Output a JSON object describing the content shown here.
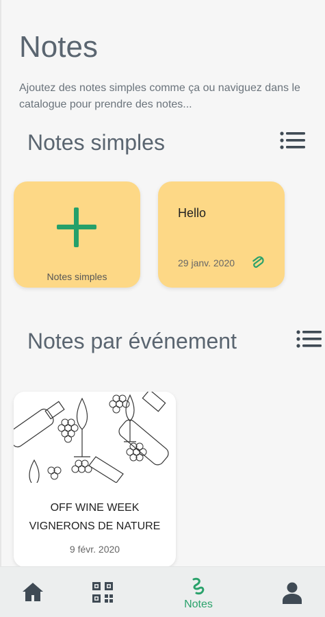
{
  "header": {
    "title": "Notes",
    "subtitle": "Ajoutez des notes simples comme ça ou naviguez dans le catalogue pour prendre des notes..."
  },
  "simple_notes": {
    "section_title": "Notes simples",
    "list_icon": "list-icon",
    "add_card": {
      "icon": "plus-icon",
      "label": "Notes simples"
    },
    "notes": [
      {
        "title": "Hello",
        "date": "29 janv. 2020",
        "icon": "paperclip-icon"
      }
    ]
  },
  "event_notes": {
    "section_title": "Notes par événement",
    "list_icon": "list-icon",
    "events": [
      {
        "title_line1": "OFF WINE WEEK",
        "title_line2": "VIGNERONS DE NATURE",
        "date": "9 févr. 2020",
        "image": "wine-illustration"
      }
    ]
  },
  "bottom_nav": {
    "items": [
      {
        "icon": "home-icon",
        "label": ""
      },
      {
        "icon": "qr-code-icon",
        "label": ""
      },
      {
        "icon": "notes-icon",
        "label": "Notes",
        "active": true
      },
      {
        "icon": "profile-icon",
        "label": ""
      }
    ]
  },
  "colors": {
    "card_background": "#fdd886",
    "accent_green": "#2aa26b",
    "page_background": "#f6f6f6",
    "nav_background": "#eceeee"
  }
}
